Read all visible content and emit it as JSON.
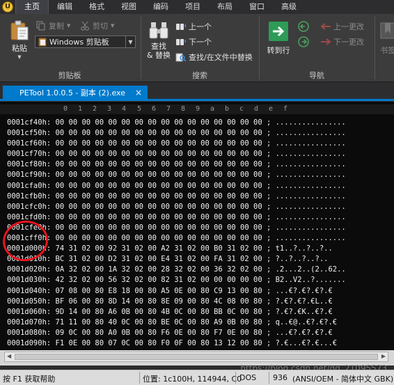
{
  "menu": {
    "items": [
      "主页",
      "编辑",
      "格式",
      "视图",
      "编码",
      "项目",
      "布局",
      "窗口",
      "高级"
    ],
    "active": "主页"
  },
  "ribbon": {
    "clipboard": {
      "paste_label": "粘贴",
      "copy_label": "复制",
      "cut_label": "剪切",
      "clipboard_select": "Windows 剪贴板",
      "group_label": "剪贴板"
    },
    "search": {
      "find_replace_label_1": "查找",
      "find_replace_label_2": "& 替换",
      "prev_label": "上一个",
      "next_label": "下一个",
      "find_in_files_label": "查找/在文件中替换",
      "group_label": "搜索"
    },
    "navigation": {
      "goto_label": "转到行",
      "prev_change_label": "上一更改",
      "next_change_label": "下一更改",
      "group_label": "导航"
    },
    "bookmarks": {
      "label": "书签"
    }
  },
  "document_tab": {
    "title": "PETool 1.0.0.5 - 副本 (2).exe",
    "close": "×"
  },
  "hex": {
    "columns": [
      "0",
      "1",
      "2",
      "3",
      "4",
      "5",
      "6",
      "7",
      "8",
      "9",
      "a",
      "b",
      "c",
      "d",
      "e",
      "f"
    ],
    "lines": [
      "0001cf40h: 00 00 00 00 00 00 00 00 00 00 00 00 00 00 00 00 ; ................",
      "0001cf50h: 00 00 00 00 00 00 00 00 00 00 00 00 00 00 00 00 ; ................",
      "0001cf60h: 00 00 00 00 00 00 00 00 00 00 00 00 00 00 00 00 ; ................",
      "0001cf70h: 00 00 00 00 00 00 00 00 00 00 00 00 00 00 00 00 ; ................",
      "0001cf80h: 00 00 00 00 00 00 00 00 00 00 00 00 00 00 00 00 ; ................",
      "0001cf90h: 00 00 00 00 00 00 00 00 00 00 00 00 00 00 00 00 ; ................",
      "0001cfa0h: 00 00 00 00 00 00 00 00 00 00 00 00 00 00 00 00 ; ................",
      "0001cfb0h: 00 00 00 00 00 00 00 00 00 00 00 00 00 00 00 00 ; ................",
      "0001cfc0h: 00 00 00 00 00 00 00 00 00 00 00 00 00 00 00 00 ; ................",
      "0001cfd0h: 00 00 00 00 00 00 00 00 00 00 00 00 00 00 00 00 ; ................",
      "0001cfe0h: 00 00 00 00 00 00 00 00 00 00 00 00 00 00 00 00 ; ................",
      "0001cff0h: 00 00 00 00 00 00 00 00 00 00 00 00 00 00 00 00 ; ................",
      "0001d000h: 74 31 02 00 92 31 02 00 A2 31 02 00 B0 31 02 00 ; t1..?..?..?..",
      "0001d010h: BC 31 02 00 D2 31 02 00 E4 31 02 00 FA 31 02 00 ; ?..?..?..?..",
      "0001d020h: 0A 32 02 00 1A 32 02 00 28 32 02 00 36 32 02 00 ; .2...2..(2..62..",
      "0001d030h: 42 32 02 00 56 32 02 00 82 31 02 00 00 00 00 00 ; B2..V2..?.......",
      "0001d040h: 07 08 00 80 E8 18 00 80 A5 0E 00 80 C9 13 00 80 ; ...€?.€?.€?.€",
      "0001d050h: BF 06 00 80 8D 14 00 80 8E 09 00 80 4C 08 00 80 ; ?.€?.€?.€L..€",
      "0001d060h: 9D 14 00 80 A6 0B 00 80 4B 0C 00 80 BB 0C 00 80 ; ?.€?.€K..€?.€",
      "0001d070h: 71 11 00 80 40 0C 00 80 BE 0C 00 80 A9 0B 00 80 ; q..€@..€?.€?.€",
      "0001d080h: 09 0C 00 80 A0 0B 00 80 F6 0E 00 80 F7 0E 00 80 ; ...€?.€?.€?.€",
      "0001d090h: F1 0E 00 80 07 0C 00 80 F0 0F 00 80 13 12 00 80 ; ?.€...€?.€...€"
    ]
  },
  "status": {
    "help": "按 F1 获取帮助",
    "position": "位置: 1c100H, 114944, C0",
    "line_ending": "DOS",
    "codepage": "936",
    "encoding": "(ANSI/OEM - 简体中文 GBK)"
  },
  "watermark": "https://blog.csdn.net/qq_21095573"
}
